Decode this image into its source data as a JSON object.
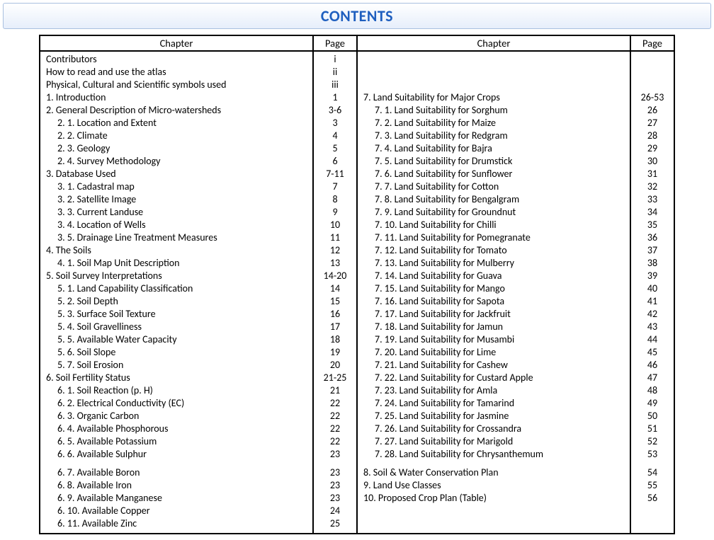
{
  "title": "CONTENTS",
  "headers": {
    "chapter": "Chapter",
    "page": "Page"
  },
  "left": [
    {
      "label": "Contributors",
      "page": "i",
      "indent": false
    },
    {
      "label": "How to read and use the atlas",
      "page": "ii",
      "indent": false
    },
    {
      "label": "Physical, Cultural and Scientific symbols used",
      "page": "iii",
      "indent": false
    },
    {
      "label": "1. Introduction",
      "page": "1",
      "indent": false
    },
    {
      "label": "2. General Description of Micro-watersheds",
      "page": "3-6",
      "indent": false
    },
    {
      "label": "2. 1. Location and Extent",
      "page": "3",
      "indent": true
    },
    {
      "label": "2. 2. Climate",
      "page": "4",
      "indent": true
    },
    {
      "label": "2. 3. Geology",
      "page": "5",
      "indent": true
    },
    {
      "label": "2. 4. Survey Methodology",
      "page": "6",
      "indent": true
    },
    {
      "label": "3. Database Used",
      "page": "7-11",
      "indent": false
    },
    {
      "label": "3. 1. Cadastral map",
      "page": "7",
      "indent": true
    },
    {
      "label": "3. 2. Satellite Image",
      "page": "8",
      "indent": true
    },
    {
      "label": "3. 3. Current Landuse",
      "page": "9",
      "indent": true
    },
    {
      "label": "3. 4. Location of Wells",
      "page": "10",
      "indent": true
    },
    {
      "label": "3. 5. Drainage Line Treatment Measures",
      "page": "11",
      "indent": true
    },
    {
      "label": "4. The Soils",
      "page": "12",
      "indent": false
    },
    {
      "label": "4. 1. Soil Map Unit Description",
      "page": "13",
      "indent": true
    },
    {
      "label": "5. Soil Survey Interpretations",
      "page": "14-20",
      "indent": false
    },
    {
      "label": "5. 1. Land Capability Classification",
      "page": "14",
      "indent": true
    },
    {
      "label": "5. 2. Soil Depth",
      "page": "15",
      "indent": true
    },
    {
      "label": "5. 3. Surface Soil Texture",
      "page": "16",
      "indent": true
    },
    {
      "label": "5. 4. Soil Gravelliness",
      "page": "17",
      "indent": true
    },
    {
      "label": "5. 5. Available Water Capacity",
      "page": "18",
      "indent": true
    },
    {
      "label": "5. 6. Soil Slope",
      "page": "19",
      "indent": true
    },
    {
      "label": "5. 7. Soil Erosion",
      "page": "20",
      "indent": true
    },
    {
      "label": "6. Soil Fertility Status",
      "page": "21-25",
      "indent": false
    },
    {
      "label": "6. 1. Soil Reaction (p. H)",
      "page": "21",
      "indent": true
    },
    {
      "label": "6. 2. Electrical Conductivity (EC)",
      "page": "22",
      "indent": true
    },
    {
      "label": "6. 3. Organic Carbon",
      "page": "22",
      "indent": true
    },
    {
      "label": "6. 4. Available  Phosphorous",
      "page": "22",
      "indent": true
    },
    {
      "label": "6. 5. Available  Potassium",
      "page": "22",
      "indent": true
    },
    {
      "label": "6. 6. Available Sulphur",
      "page": "23",
      "indent": true
    }
  ],
  "left2": [
    {
      "label": "6. 7. Available Boron",
      "page": "23",
      "indent": true
    },
    {
      "label": "6. 8. Available Iron",
      "page": "23",
      "indent": true
    },
    {
      "label": "6. 9. Available Manganese",
      "page": "23",
      "indent": true
    },
    {
      "label": "6. 10. Available Copper",
      "page": "24",
      "indent": true
    },
    {
      "label": "6. 11. Available Zinc",
      "page": "25",
      "indent": true
    }
  ],
  "right": [
    {
      "label": "7. Land Suitability for Major Crops",
      "page": "26-53",
      "indent": false
    },
    {
      "label": "7. 1. Land Suitability for Sorghum",
      "page": "26",
      "indent": true
    },
    {
      "label": "7. 2. Land Suitability for Maize",
      "page": "27",
      "indent": true
    },
    {
      "label": "7. 3. Land Suitability for Redgram",
      "page": "28",
      "indent": true
    },
    {
      "label": "7. 4. Land Suitability for Bajra",
      "page": "29",
      "indent": true
    },
    {
      "label": "7. 5. Land Suitability for Drumstick",
      "page": "30",
      "indent": true
    },
    {
      "label": "7. 6. Land Suitability for Sunflower",
      "page": "31",
      "indent": true
    },
    {
      "label": "7. 7. Land Suitability for Cotton",
      "page": "32",
      "indent": true
    },
    {
      "label": "7. 8. Land Suitability for Bengalgram",
      "page": "33",
      "indent": true
    },
    {
      "label": "7. 9. Land Suitability for Groundnut",
      "page": "34",
      "indent": true
    },
    {
      "label": "7. 10. Land Suitability for Chilli",
      "page": "35",
      "indent": true
    },
    {
      "label": "7. 11. Land Suitability for Pomegranate",
      "page": "36",
      "indent": true
    },
    {
      "label": "7. 12. Land Suitability for Tomato",
      "page": "37",
      "indent": true
    },
    {
      "label": "7. 13. Land Suitability for Mulberry",
      "page": "38",
      "indent": true
    },
    {
      "label": "7. 14. Land Suitability for Guava",
      "page": "39",
      "indent": true
    },
    {
      "label": "7. 15. Land Suitability for Mango",
      "page": "40",
      "indent": true
    },
    {
      "label": "7. 16. Land Suitability for Sapota",
      "page": "41",
      "indent": true
    },
    {
      "label": "7. 17. Land Suitability for Jackfruit",
      "page": "42",
      "indent": true
    },
    {
      "label": "7. 18. Land Suitability for Jamun",
      "page": "43",
      "indent": true
    },
    {
      "label": "7. 19. Land Suitability for Musambi",
      "page": "44",
      "indent": true
    },
    {
      "label": "7. 20. Land Suitability for Lime",
      "page": "45",
      "indent": true
    },
    {
      "label": "7. 21. Land Suitability for Cashew",
      "page": "46",
      "indent": true
    },
    {
      "label": "7. 22. Land Suitability for Custard Apple",
      "page": "47",
      "indent": true
    },
    {
      "label": "7. 23. Land Suitability for Amla",
      "page": "48",
      "indent": true
    },
    {
      "label": "7. 24. Land Suitability for Tamarind",
      "page": "49",
      "indent": true
    },
    {
      "label": "7. 25. Land Suitability for Jasmine",
      "page": "50",
      "indent": true
    },
    {
      "label": "7. 26. Land Suitability for Crossandra",
      "page": "51",
      "indent": true
    },
    {
      "label": "7. 27. Land Suitability for Marigold",
      "page": "52",
      "indent": true
    },
    {
      "label": "7. 28. Land Suitability for Chrysanthemum",
      "page": "53",
      "indent": true
    }
  ],
  "right2": [
    {
      "label": "8. Soil & Water Conservation Plan",
      "page": "54",
      "indent": false
    },
    {
      "label": "9. Land Use Classes",
      "page": "55",
      "indent": false
    },
    {
      "label": "10. Proposed Crop Plan (Table)",
      "page": "56",
      "indent": false
    }
  ]
}
